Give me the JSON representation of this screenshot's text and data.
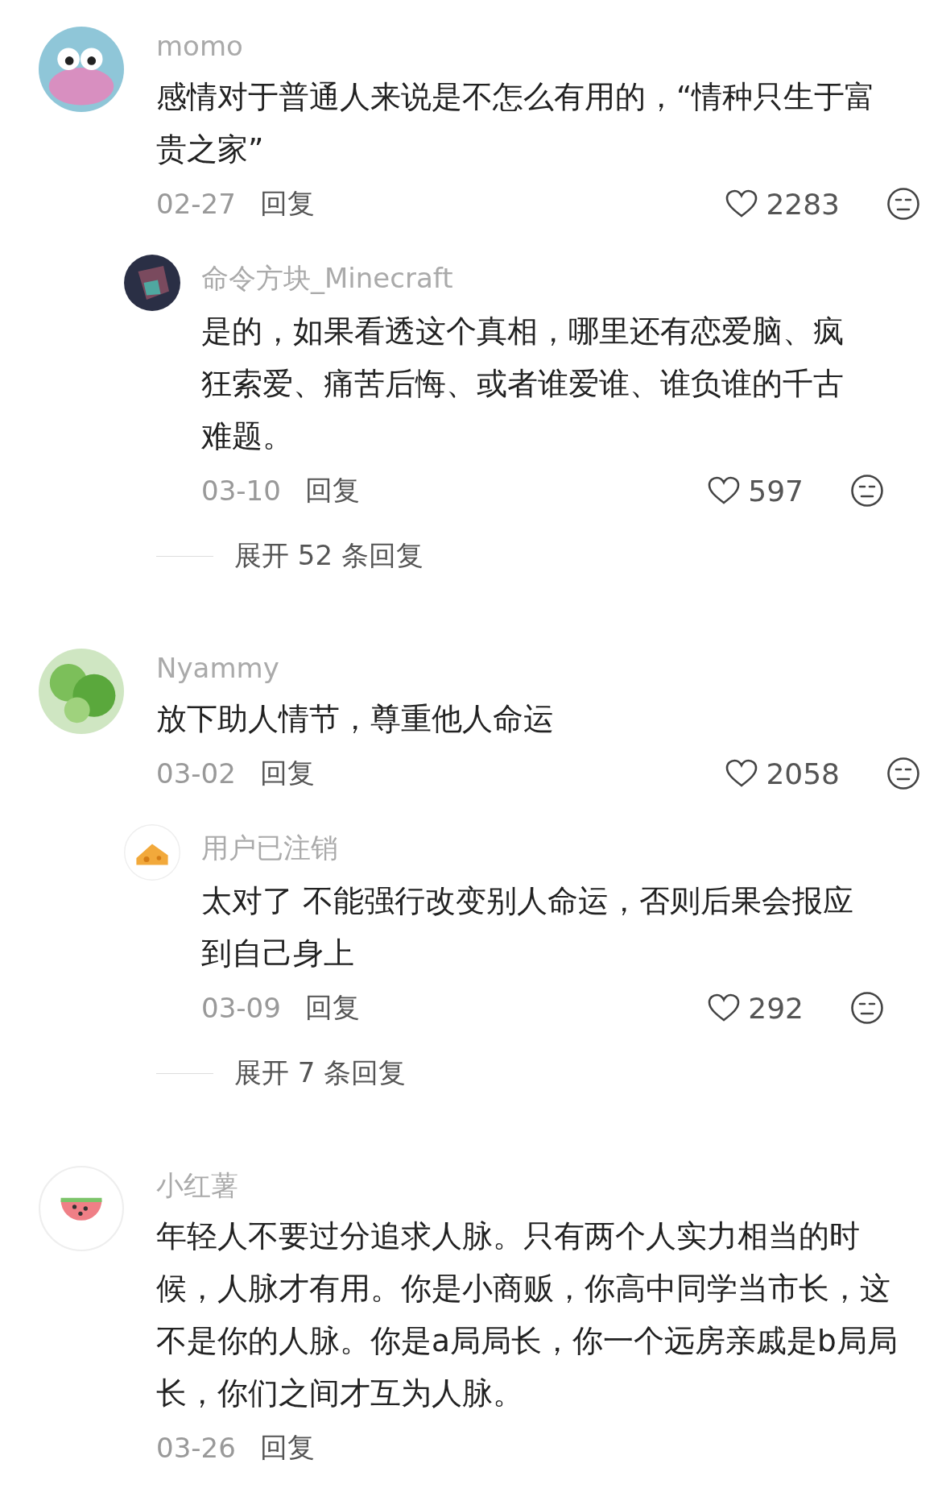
{
  "comments": [
    {
      "user": "momo",
      "text": "感情对于普通人来说是不怎么有用的，“情种只生于富贵之家”",
      "date": "02-27",
      "reply_label": "回复",
      "likes": "2283",
      "replies": [
        {
          "user": "命令方块_Minecraft",
          "text": "是的，如果看透这个真相，哪里还有恋爱脑、疯狂索爱、痛苦后悔、或者谁爱谁、谁负谁的千古难题。",
          "date": "03-10",
          "reply_label": "回复",
          "likes": "597"
        }
      ],
      "expand": "展开 52 条回复"
    },
    {
      "user": "Nyammy",
      "text": "放下助人情节，尊重他人命运",
      "date": "03-02",
      "reply_label": "回复",
      "likes": "2058",
      "replies": [
        {
          "user": "用户已注销",
          "text": "太对了  不能强行改变别人命运，否则后果会报应到自己身上",
          "date": "03-09",
          "reply_label": "回复",
          "likes": "292"
        }
      ],
      "expand": "展开 7 条回复"
    },
    {
      "user": "小红薯",
      "text": "年轻人不要过分追求人脉。只有两个人实力相当的时候，人脉才有用。你是小商贩，你高中同学当市长，这不是你的人脉。你是a局局长，你一个远房亲戚是b局局长，你们之间才互为人脉。",
      "date": "03-26",
      "reply_label": "回复"
    }
  ]
}
